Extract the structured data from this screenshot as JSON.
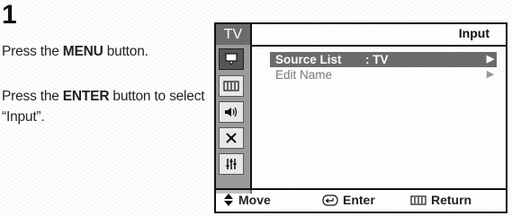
{
  "step": {
    "number": "1"
  },
  "instructions": [
    {
      "before": "Press the ",
      "bold": "MENU",
      "after": " button."
    },
    {
      "before": "Press the ",
      "bold": "ENTER",
      "after": " button to select “Input”."
    }
  ],
  "osd": {
    "sidebar_tab": "TV",
    "title": "Input",
    "sidebar_icons": [
      "picture-icon",
      "sound-icon",
      "channel-icon",
      "setup-icon",
      "input-icon",
      "applications-icon"
    ],
    "menu_items": [
      {
        "label": "Source List",
        "value": ": TV",
        "arrow": "▶",
        "selected": true
      },
      {
        "label": "Edit Name",
        "value": "",
        "arrow": "▶",
        "selected": false
      }
    ],
    "footer": {
      "move": "Move",
      "enter": "Enter",
      "return": "Return"
    }
  }
}
